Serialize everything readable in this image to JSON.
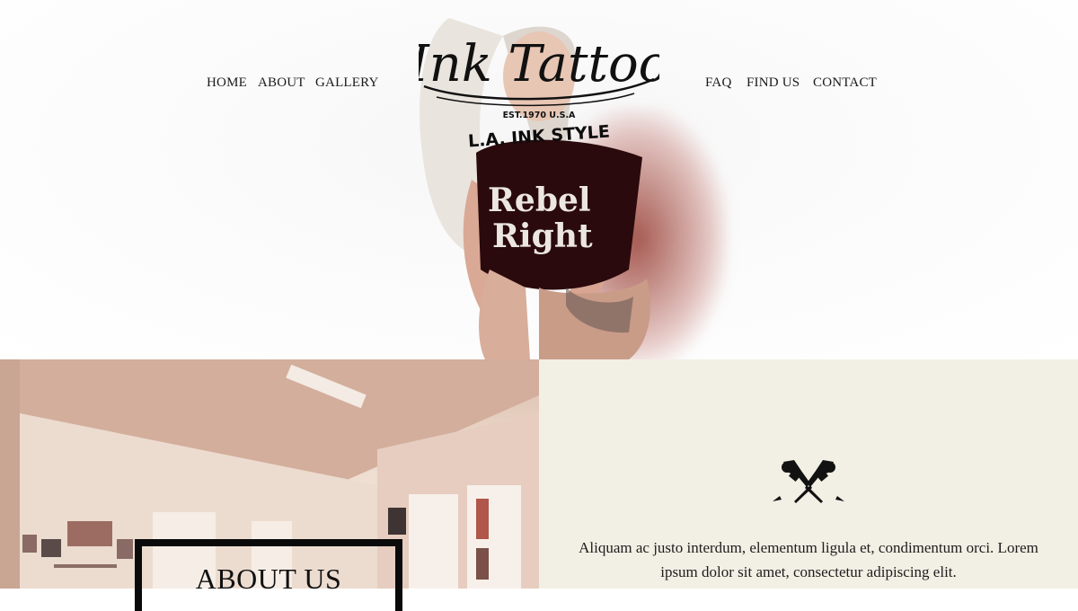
{
  "nav": {
    "left": [
      "HOME",
      "ABOUT",
      "GALLERY"
    ],
    "right": [
      "FAQ",
      "FIND US",
      "CONTACT"
    ]
  },
  "logo": {
    "script_text": "Ink Tattoo",
    "established": "EST.1970 U.S.A",
    "tagline": "L.A. INK STYLE"
  },
  "about": {
    "title": "ABOUT US",
    "body": "Aliquam ac justo interdum, elementum ligula et, condimentum orci. Lorem ipsum dolor sit amet, consectetur adipiscing elit."
  },
  "colors": {
    "panel_background": "#f2efe4",
    "text": "#1a1a1a",
    "frame": "#0a0a0a"
  },
  "icons": {
    "section_divider": "tattoo-machines-icon"
  }
}
